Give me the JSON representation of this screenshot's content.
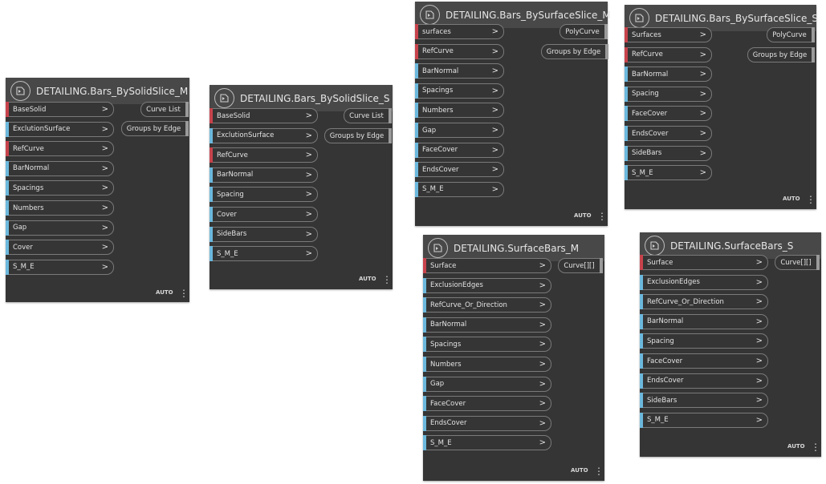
{
  "nodes": [
    {
      "title": "DETAILING.Bars_BySolidSlice_M",
      "inputs": [
        {
          "label": "BaseSolid",
          "kind": "req"
        },
        {
          "label": "ExclutionSurface",
          "kind": "opt"
        },
        {
          "label": "RefCurve",
          "kind": "req"
        },
        {
          "label": "BarNormal",
          "kind": "opt"
        },
        {
          "label": "Spacings",
          "kind": "opt"
        },
        {
          "label": "Numbers",
          "kind": "opt"
        },
        {
          "label": "Gap",
          "kind": "opt"
        },
        {
          "label": "Cover",
          "kind": "opt"
        },
        {
          "label": "S_M_E",
          "kind": "opt"
        }
      ],
      "outputs": [
        "Curve List",
        "Groups by Edge"
      ],
      "footer": "AUTO",
      "arrow": ">",
      "menu": "⋮"
    },
    {
      "title": "DETAILING.Bars_BySolidSlice_S",
      "inputs": [
        {
          "label": "BaseSolid",
          "kind": "req"
        },
        {
          "label": "ExclutionSurface",
          "kind": "opt"
        },
        {
          "label": "RefCurve",
          "kind": "req"
        },
        {
          "label": "BarNormal",
          "kind": "opt"
        },
        {
          "label": "Spacing",
          "kind": "opt"
        },
        {
          "label": "Cover",
          "kind": "opt"
        },
        {
          "label": "SideBars",
          "kind": "opt"
        },
        {
          "label": "S_M_E",
          "kind": "opt"
        }
      ],
      "outputs": [
        "Curve List",
        "Groups by Edge"
      ],
      "footer": "AUTO",
      "arrow": ">",
      "menu": "⋮"
    },
    {
      "title": "DETAILING.Bars_BySurfaceSlice_M",
      "inputs": [
        {
          "label": "surfaces",
          "kind": "req"
        },
        {
          "label": "RefCurve",
          "kind": "req"
        },
        {
          "label": "BarNormal",
          "kind": "opt"
        },
        {
          "label": "Spacings",
          "kind": "opt"
        },
        {
          "label": "Numbers",
          "kind": "opt"
        },
        {
          "label": "Gap",
          "kind": "opt"
        },
        {
          "label": "FaceCover",
          "kind": "opt"
        },
        {
          "label": "EndsCover",
          "kind": "opt"
        },
        {
          "label": "S_M_E",
          "kind": "opt"
        }
      ],
      "outputs": [
        "PolyCurve",
        "Groups by Edge"
      ],
      "footer": "AUTO",
      "arrow": ">",
      "menu": "⋮"
    },
    {
      "title": "DETAILING.Bars_BySurfaceSlice_S",
      "inputs": [
        {
          "label": "Surfaces",
          "kind": "req"
        },
        {
          "label": "RefCurve",
          "kind": "req"
        },
        {
          "label": "BarNormal",
          "kind": "opt"
        },
        {
          "label": "Spacing",
          "kind": "opt"
        },
        {
          "label": "FaceCover",
          "kind": "opt"
        },
        {
          "label": "EndsCover",
          "kind": "opt"
        },
        {
          "label": "SideBars",
          "kind": "opt"
        },
        {
          "label": "S_M_E",
          "kind": "opt"
        }
      ],
      "outputs": [
        "PolyCurve",
        "Groups by Edge"
      ],
      "footer": "AUTO",
      "arrow": ">",
      "menu": "⋮"
    },
    {
      "title": "DETAILING.SurfaceBars_M",
      "inputs": [
        {
          "label": "Surface",
          "kind": "req"
        },
        {
          "label": "ExclusionEdges",
          "kind": "opt"
        },
        {
          "label": "RefCurve_Or_Direction",
          "kind": "opt"
        },
        {
          "label": "BarNormal",
          "kind": "opt"
        },
        {
          "label": "Spacings",
          "kind": "opt"
        },
        {
          "label": "Numbers",
          "kind": "opt"
        },
        {
          "label": "Gap",
          "kind": "opt"
        },
        {
          "label": "FaceCover",
          "kind": "opt"
        },
        {
          "label": "EndsCover",
          "kind": "opt"
        },
        {
          "label": "S_M_E",
          "kind": "opt"
        }
      ],
      "outputs": [
        "Curve[][]"
      ],
      "footer": "AUTO",
      "arrow": ">",
      "menu": "⋮"
    },
    {
      "title": "DETAILING.SurfaceBars_S",
      "inputs": [
        {
          "label": "Surface",
          "kind": "req"
        },
        {
          "label": "ExclusionEdges",
          "kind": "opt"
        },
        {
          "label": "RefCurve_Or_Direction",
          "kind": "opt"
        },
        {
          "label": "BarNormal",
          "kind": "opt"
        },
        {
          "label": "Spacing",
          "kind": "opt"
        },
        {
          "label": "FaceCover",
          "kind": "opt"
        },
        {
          "label": "EndsCover",
          "kind": "opt"
        },
        {
          "label": "SideBars",
          "kind": "opt"
        },
        {
          "label": "S_M_E",
          "kind": "opt"
        }
      ],
      "outputs": [
        "Curve[][]"
      ],
      "footer": "AUTO",
      "arrow": ">",
      "menu": "⋮"
    }
  ]
}
